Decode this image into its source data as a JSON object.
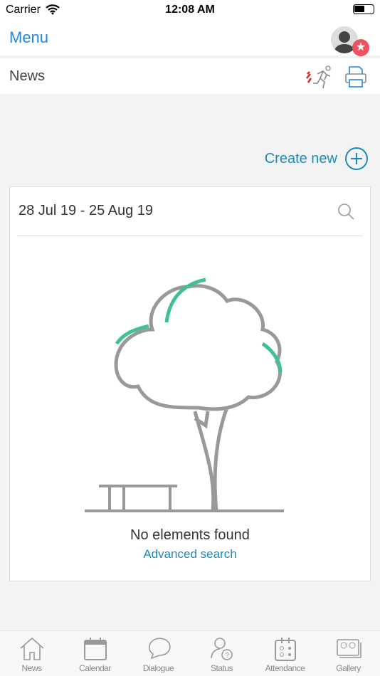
{
  "status_bar": {
    "carrier": "Carrier",
    "time": "12:08 AM"
  },
  "nav": {
    "menu_label": "Menu",
    "badge_icon": "star-icon"
  },
  "subheader": {
    "title": "News",
    "icons": [
      "fire-exit-icon",
      "printer-icon"
    ]
  },
  "create_new_label": "Create new",
  "card": {
    "date_range": "28 Jul 19 - 25 Aug 19",
    "empty_text": "No elements found",
    "advanced_search": "Advanced search"
  },
  "tabs": [
    {
      "label": "News"
    },
    {
      "label": "Calendar"
    },
    {
      "label": "Dialogue"
    },
    {
      "label": "Status"
    },
    {
      "label": "Attendance"
    },
    {
      "label": "Gallery"
    }
  ],
  "colors": {
    "accent": "#1e88e5",
    "link": "#1a8cbf",
    "badge": "#ef5361",
    "tree_leaf": "#3fbf9a"
  }
}
